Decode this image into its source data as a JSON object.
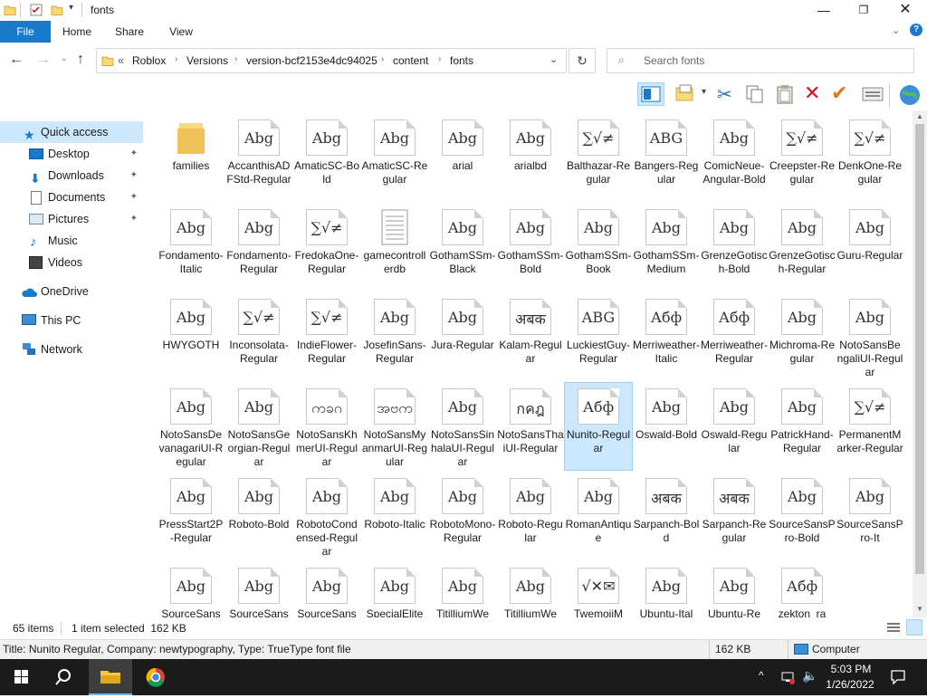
{
  "window": {
    "title": "fonts"
  },
  "ribbon": {
    "tabs": [
      "File",
      "Home",
      "Share",
      "View"
    ]
  },
  "address": {
    "breadcrumbs": [
      "Roblox",
      "Versions",
      "version-bcf2153e4dc94025",
      "content",
      "fonts"
    ],
    "overflow": "«"
  },
  "search": {
    "placeholder": "Search fonts"
  },
  "nav": {
    "items": [
      {
        "label": "Quick access",
        "icon": "star-icon"
      },
      {
        "label": "Desktop",
        "icon": "desktop-icon",
        "pinned": true
      },
      {
        "label": "Downloads",
        "icon": "download-icon",
        "pinned": true
      },
      {
        "label": "Documents",
        "icon": "documents-icon",
        "pinned": true
      },
      {
        "label": "Pictures",
        "icon": "pictures-icon",
        "pinned": true
      },
      {
        "label": "Music",
        "icon": "music-icon"
      },
      {
        "label": "Videos",
        "icon": "videos-icon"
      },
      {
        "label": "OneDrive",
        "icon": "cloud-icon"
      },
      {
        "label": "This PC",
        "icon": "computer-icon"
      },
      {
        "label": "Network",
        "icon": "network-icon"
      }
    ],
    "pin_glyph": "📌"
  },
  "files": [
    {
      "name": "families",
      "glyph": "",
      "type": "folder"
    },
    {
      "name": "AccanthisADFStd-Regular",
      "glyph": "Abg"
    },
    {
      "name": "AmaticSC-Bold",
      "glyph": "Abg"
    },
    {
      "name": "AmaticSC-Regular",
      "glyph": "Abg"
    },
    {
      "name": "arial",
      "glyph": "Abg"
    },
    {
      "name": "arialbd",
      "glyph": "Abg"
    },
    {
      "name": "Balthazar-Regular",
      "glyph": "∑√≠"
    },
    {
      "name": "Bangers-Regular",
      "glyph": "ABG"
    },
    {
      "name": "ComicNeue-Angular-Bold",
      "glyph": "Abg"
    },
    {
      "name": "Creepster-Regular",
      "glyph": "∑√≠"
    },
    {
      "name": "DenkOne-Regular",
      "glyph": "∑√≠"
    },
    {
      "name": "Fondamento-Italic",
      "glyph": "Abg"
    },
    {
      "name": "Fondamento-Regular",
      "glyph": "Abg"
    },
    {
      "name": "FredokaOne-Regular",
      "glyph": "∑√≠"
    },
    {
      "name": "gamecontrollerdb",
      "glyph": "",
      "type": "text"
    },
    {
      "name": "GothamSSm-Black",
      "glyph": "Abg"
    },
    {
      "name": "GothamSSm-Bold",
      "glyph": "Abg"
    },
    {
      "name": "GothamSSm-Book",
      "glyph": "Abg"
    },
    {
      "name": "GothamSSm-Medium",
      "glyph": "Abg"
    },
    {
      "name": "GrenzeGotisch-Bold",
      "glyph": "Abg"
    },
    {
      "name": "GrenzeGotisch-Regular",
      "glyph": "Abg"
    },
    {
      "name": "Guru-Regular",
      "glyph": "Abg"
    },
    {
      "name": "HWYGOTH",
      "glyph": "Abg"
    },
    {
      "name": "Inconsolata-Regular",
      "glyph": "∑√≠"
    },
    {
      "name": "IndieFlower-Regular",
      "glyph": "∑√≠"
    },
    {
      "name": "JosefinSans-Regular",
      "glyph": "Abg"
    },
    {
      "name": "Jura-Regular",
      "glyph": "Abg"
    },
    {
      "name": "Kalam-Regular",
      "glyph": "अबक"
    },
    {
      "name": "LuckiestGuy-Regular",
      "glyph": "ABG"
    },
    {
      "name": "Merriweather-Italic",
      "glyph": "Абф"
    },
    {
      "name": "Merriweather-Regular",
      "glyph": "Абф"
    },
    {
      "name": "Michroma-Regular",
      "glyph": "Abg"
    },
    {
      "name": "NotoSansBengaliUI-Regular",
      "glyph": "Abg"
    },
    {
      "name": "NotoSansDevanagariUI-Regular",
      "glyph": "Abg"
    },
    {
      "name": "NotoSansGeorgian-Regular",
      "glyph": "Abg"
    },
    {
      "name": "NotoSansKhmerUI-Regular",
      "glyph": "ကခဂ"
    },
    {
      "name": "NotoSansMyanmarUI-Regular",
      "glyph": "အဗက"
    },
    {
      "name": "NotoSansSinhalaUI-Regular",
      "glyph": "Abg"
    },
    {
      "name": "NotoSansThaiUI-Regular",
      "glyph": "กคฎ"
    },
    {
      "name": "Nunito-Regular",
      "glyph": "Абф",
      "selected": true
    },
    {
      "name": "Oswald-Bold",
      "glyph": "Abg"
    },
    {
      "name": "Oswald-Regular",
      "glyph": "Abg"
    },
    {
      "name": "PatrickHand-Regular",
      "glyph": "Abg"
    },
    {
      "name": "PermanentMarker-Regular",
      "glyph": "∑√≠"
    },
    {
      "name": "PressStart2P-Regular",
      "glyph": "Abg"
    },
    {
      "name": "Roboto-Bold",
      "glyph": "Abg"
    },
    {
      "name": "RobotoCondensed-Regular",
      "glyph": "Abg"
    },
    {
      "name": "Roboto-Italic",
      "glyph": "Abg"
    },
    {
      "name": "RobotoMono-Regular",
      "glyph": "Abg"
    },
    {
      "name": "Roboto-Regular",
      "glyph": "Abg"
    },
    {
      "name": "RomanAntique",
      "glyph": "Abg"
    },
    {
      "name": "Sarpanch-Bold",
      "glyph": "अबक"
    },
    {
      "name": "Sarpanch-Regular",
      "glyph": "अबक"
    },
    {
      "name": "SourceSansPro-Bold",
      "glyph": "Abg"
    },
    {
      "name": "SourceSansPro-It",
      "glyph": "Abg"
    },
    {
      "name": "SourceSans",
      "glyph": "Abg"
    },
    {
      "name": "SourceSans",
      "glyph": "Abg"
    },
    {
      "name": "SourceSans",
      "glyph": "Abg"
    },
    {
      "name": "SpecialElite",
      "glyph": "Abg"
    },
    {
      "name": "TitilliumWe",
      "glyph": "Abg"
    },
    {
      "name": "TitilliumWe",
      "glyph": "Abg"
    },
    {
      "name": "TwemojiM",
      "glyph": "√✕✉"
    },
    {
      "name": "Ubuntu-Ital",
      "glyph": "Abg"
    },
    {
      "name": "Ubuntu-Re",
      "glyph": "Abg"
    },
    {
      "name": "zekton_ra",
      "glyph": "Абф"
    }
  ],
  "status": {
    "items_count": "65 items",
    "selection": "1 item selected  162 KB"
  },
  "info": {
    "details": "Title: Nunito Regular, Company: newtypography, Type: TrueType font file",
    "size": "162 KB",
    "location": "Computer"
  },
  "taskbar": {
    "time": "5:03 PM",
    "date": "1/26/2022"
  },
  "colors": {
    "accent": "#1979ca",
    "selection": "#cce8ff",
    "taskbar": "#1b1b1b"
  }
}
